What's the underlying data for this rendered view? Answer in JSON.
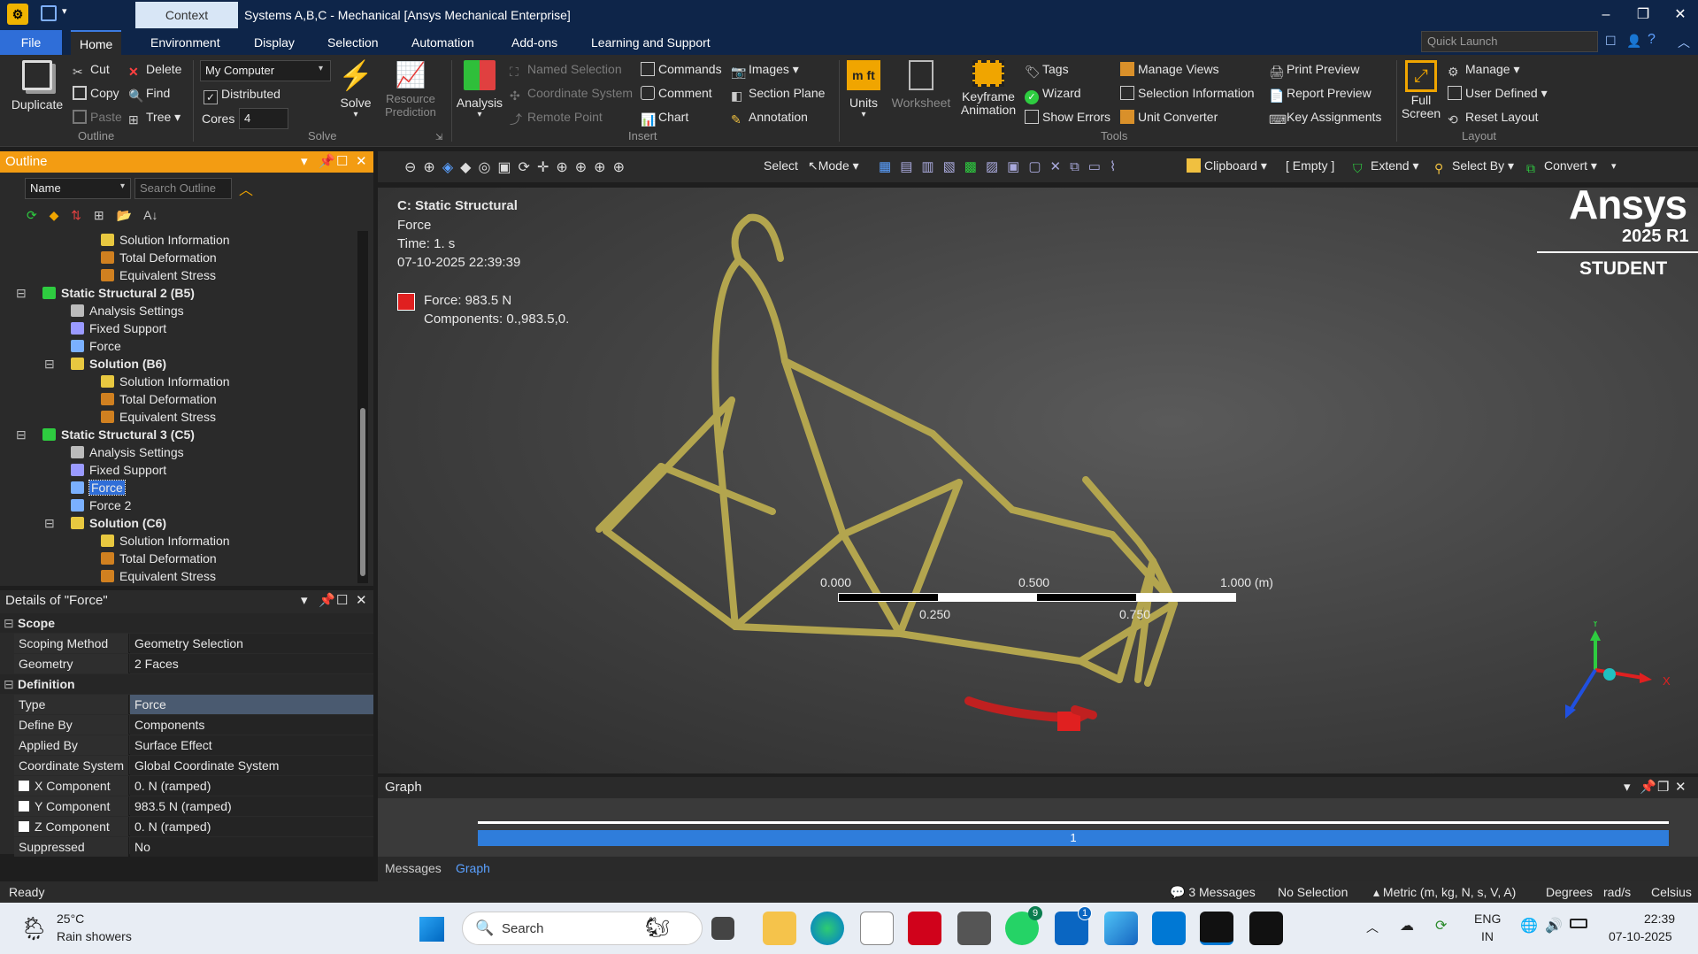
{
  "app": {
    "context_tab": "Context",
    "title": "Systems A,B,C - Mechanical [Ansys Mechanical Enterprise]"
  },
  "menu": {
    "file": "File",
    "tabs": [
      "Home",
      "Environment",
      "Display",
      "Selection",
      "Automation",
      "Add-ons",
      "Learning and Support"
    ],
    "quick_launch_placeholder": "Quick Launch"
  },
  "ribbon": {
    "outline": {
      "duplicate": "Duplicate",
      "cut": "Cut",
      "copy": "Copy",
      "paste": "Paste",
      "delete": "Delete",
      "find": "Find",
      "tree": "Tree",
      "group": "Outline"
    },
    "solve": {
      "computer": "My Computer",
      "distributed": "Distributed",
      "cores_label": "Cores",
      "cores_value": "4",
      "solve": "Solve",
      "resource_prediction": "Resource\nPrediction",
      "group": "Solve"
    },
    "insert": {
      "analysis": "Analysis",
      "named_selection": "Named Selection",
      "coordinate_system": "Coordinate System",
      "remote_point": "Remote Point",
      "commands": "Commands",
      "comment": "Comment",
      "chart": "Chart",
      "images": "Images",
      "section_plane": "Section Plane",
      "annotation": "Annotation",
      "group": "Insert"
    },
    "tools": {
      "units": "Units",
      "worksheet": "Worksheet",
      "keyframe": "Keyframe\nAnimation",
      "tags": "Tags",
      "wizard": "Wizard",
      "show_errors": "Show Errors",
      "manage_views": "Manage Views",
      "selection_information": "Selection Information",
      "unit_converter": "Unit Converter",
      "print_preview": "Print Preview",
      "report_preview": "Report Preview",
      "key_assignments": "Key Assignments",
      "group": "Tools"
    },
    "layout": {
      "full_screen": "Full\nScreen",
      "manage": "Manage",
      "user_defined": "User Defined",
      "reset_layout": "Reset Layout",
      "group": "Layout"
    }
  },
  "outline": {
    "title": "Outline",
    "filter_name": "Name",
    "search_placeholder": "Search Outline",
    "rows": [
      {
        "label": "Solution Information",
        "level": 4,
        "kind": "info",
        "bold": false,
        "selected": false
      },
      {
        "label": "Total Deformation",
        "level": 4,
        "kind": "result",
        "bold": false,
        "selected": false
      },
      {
        "label": "Equivalent Stress",
        "level": 4,
        "kind": "result",
        "bold": false,
        "selected": false
      },
      {
        "label": "Static Structural 2 (B5)",
        "level": 2,
        "kind": "analysis",
        "bold": true,
        "selected": false,
        "expander": "⊟"
      },
      {
        "label": "Analysis Settings",
        "level": 3,
        "kind": "settings",
        "bold": false,
        "selected": false
      },
      {
        "label": "Fixed Support",
        "level": 3,
        "kind": "support",
        "bold": false,
        "selected": false
      },
      {
        "label": "Force",
        "level": 3,
        "kind": "force",
        "bold": false,
        "selected": false
      },
      {
        "label": "Solution (B6)",
        "level": 3,
        "kind": "solution",
        "bold": true,
        "selected": false,
        "expander": "⊟"
      },
      {
        "label": "Solution Information",
        "level": 4,
        "kind": "info",
        "bold": false,
        "selected": false
      },
      {
        "label": "Total Deformation",
        "level": 4,
        "kind": "result",
        "bold": false,
        "selected": false
      },
      {
        "label": "Equivalent Stress",
        "level": 4,
        "kind": "result",
        "bold": false,
        "selected": false
      },
      {
        "label": "Static Structural 3 (C5)",
        "level": 2,
        "kind": "analysis",
        "bold": true,
        "selected": false,
        "expander": "⊟"
      },
      {
        "label": "Analysis Settings",
        "level": 3,
        "kind": "settings",
        "bold": false,
        "selected": false
      },
      {
        "label": "Fixed Support",
        "level": 3,
        "kind": "support",
        "bold": false,
        "selected": false
      },
      {
        "label": "Force",
        "level": 3,
        "kind": "force",
        "bold": false,
        "selected": true
      },
      {
        "label": "Force 2",
        "level": 3,
        "kind": "force",
        "bold": false,
        "selected": false
      },
      {
        "label": "Solution (C6)",
        "level": 3,
        "kind": "solution",
        "bold": true,
        "selected": false,
        "expander": "⊟"
      },
      {
        "label": "Solution Information",
        "level": 4,
        "kind": "info",
        "bold": false,
        "selected": false
      },
      {
        "label": "Total Deformation",
        "level": 4,
        "kind": "result",
        "bold": false,
        "selected": false
      },
      {
        "label": "Equivalent Stress",
        "level": 4,
        "kind": "result",
        "bold": false,
        "selected": false
      }
    ]
  },
  "details": {
    "title": "Details of \"Force\"",
    "scope_label": "Scope",
    "scope": [
      {
        "k": "Scoping Method",
        "v": "Geometry Selection"
      },
      {
        "k": "Geometry",
        "v": "2 Faces"
      }
    ],
    "definition_label": "Definition",
    "definition": [
      {
        "k": "Type",
        "v": "Force",
        "cb": false
      },
      {
        "k": "Define By",
        "v": "Components",
        "cb": false
      },
      {
        "k": "Applied By",
        "v": "Surface Effect",
        "cb": false
      },
      {
        "k": "Coordinate System",
        "v": "Global Coordinate System",
        "cb": false
      },
      {
        "k": "X Component",
        "v": "0. N  (ramped)",
        "cb": true
      },
      {
        "k": "Y Component",
        "v": "983.5 N  (ramped)",
        "cb": true
      },
      {
        "k": "Z Component",
        "v": "0. N  (ramped)",
        "cb": true
      },
      {
        "k": "Suppressed",
        "v": "No",
        "cb": false
      }
    ]
  },
  "viewtoolbar": {
    "select": "Select",
    "mode": "Mode",
    "clipboard": "Clipboard",
    "empty": "[ Empty ]",
    "extend": "Extend",
    "select_by": "Select By",
    "convert": "Convert"
  },
  "viewport": {
    "analysis": "C: Static Structural",
    "object": "Force",
    "time": "Time: 1. s",
    "date": "07-10-2025 22:39:39",
    "legend_label": "Force: 983.5 N",
    "legend_components": "Components: 0.,983.5,0.",
    "brand": "Ansys",
    "version": "2025 R1",
    "edition": "STUDENT",
    "scale_top": [
      "0.000",
      "0.500",
      "1.000 (m)"
    ],
    "scale_bottom": [
      "0.250",
      "0.750"
    ],
    "axis_x": "X",
    "axis_y": "Y"
  },
  "graph": {
    "title": "Graph",
    "step": "1"
  },
  "bottom_tabs": {
    "messages": "Messages",
    "graph": "Graph"
  },
  "status": {
    "ready": "Ready",
    "messages": "3 Messages",
    "selection": "No Selection",
    "units": "Metric (m, kg, N, s, V, A)",
    "degrees": "Degrees",
    "rads": "rad/s",
    "temp": "Celsius"
  },
  "taskbar": {
    "weather_temp": "25°C",
    "weather_desc": "Rain showers",
    "search": "Search",
    "lang1": "ENG",
    "lang2": "IN",
    "time": "22:39",
    "date": "07-10-2025",
    "badge_whatsapp": "9",
    "badge_linkedin": "1"
  },
  "colors": {
    "titlebar": "#0e2549",
    "accent": "#2f6ed8",
    "outline_header": "#f39c12",
    "frame": "#b3a54e",
    "force": "#e02020"
  }
}
